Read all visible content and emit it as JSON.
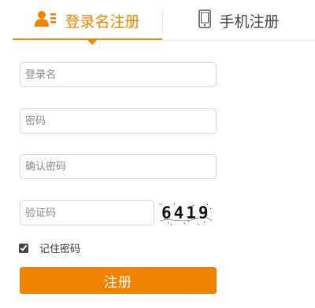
{
  "tabs": {
    "login_name": {
      "label": "登录名注册",
      "icon": "user-list-icon",
      "active": true
    },
    "mobile": {
      "label": "手机注册",
      "icon": "mobile-phone-icon",
      "active": false
    }
  },
  "form": {
    "username": {
      "value": "",
      "placeholder": "登录名"
    },
    "password": {
      "value": "",
      "placeholder": "密码"
    },
    "confirm_password": {
      "value": "",
      "placeholder": "确认密码"
    },
    "captcha": {
      "value": "",
      "placeholder": "验证码",
      "image_text": "6419"
    },
    "remember": {
      "label": "记住密码",
      "checked": true
    },
    "submit_label": "注册"
  },
  "colors": {
    "accent": "#f08300",
    "border": "#d6d6d6",
    "text": "#333333"
  }
}
